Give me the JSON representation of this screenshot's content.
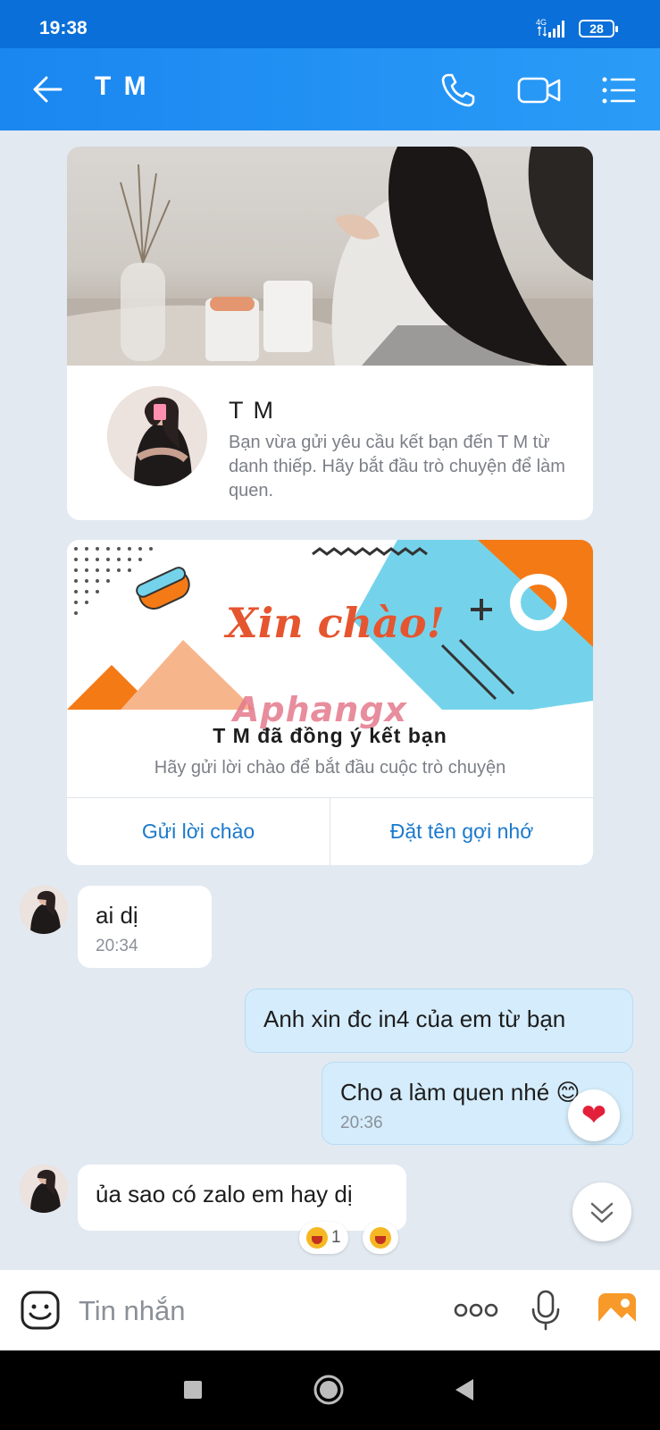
{
  "status": {
    "time": "19:38",
    "network": "4G",
    "battery": "28"
  },
  "header": {
    "title": "T M"
  },
  "profile_card": {
    "name": "T M",
    "description": "Bạn vừa gửi yêu cầu kết bạn đến T M từ danh thiếp. Hãy bắt đầu trò chuyện để làm quen."
  },
  "friend_card": {
    "banner_text": "Xin chào!",
    "watermark": "Aphangx",
    "title": "T M đã đồng ý kết bạn",
    "subtitle": "Hãy gửi lời chào để bắt đầu cuộc trò chuyện",
    "actions": [
      "Gửi lời chào",
      "Đặt tên gợi nhớ"
    ]
  },
  "messages": [
    {
      "direction": "in",
      "text": "ai dị",
      "time": "20:34"
    },
    {
      "direction": "out",
      "text": "Anh xin đc in4 của em từ bạn"
    },
    {
      "direction": "out",
      "text": "Cho a làm quen nhé 😊",
      "time": "20:36",
      "reaction": "heart"
    },
    {
      "direction": "in",
      "text": "ủa sao có zalo em hay dị",
      "reactions": [
        {
          "emoji": "laugh",
          "count": "1"
        },
        {
          "emoji": "laugh",
          "count": ""
        }
      ]
    }
  ],
  "input": {
    "placeholder": "Tin nhắn"
  },
  "icons": {
    "header": [
      "back-arrow-icon",
      "phone-icon",
      "video-call-icon",
      "menu-list-icon"
    ],
    "input": [
      "sticker-icon",
      "more-dots-icon",
      "microphone-icon",
      "image-icon"
    ],
    "nav": [
      "recent-apps-icon",
      "home-icon",
      "back-icon"
    ]
  },
  "colors": {
    "header": "#1a86f0",
    "statusbar": "#0a6fd8",
    "out_bubble": "#d4ecfb",
    "action_text": "#1b79cc",
    "background": "#e2e9f1"
  }
}
